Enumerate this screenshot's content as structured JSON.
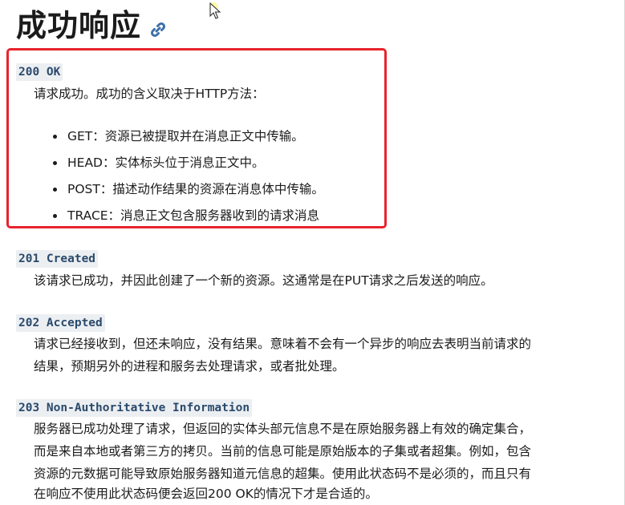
{
  "page": {
    "heading": "成功响应",
    "anchor_icon": "link-icon"
  },
  "colors": {
    "highlight_border": "#e8232c",
    "code_text": "#2b4a6b",
    "code_bg": "#eceff2",
    "link": "#3d6fa8"
  },
  "entries": [
    {
      "code": "200 OK",
      "description": "请求成功。成功的含义取决于HTTP方法：",
      "bullets": [
        "GET：资源已被提取并在消息正文中传输。",
        "HEAD：实体标头位于消息正文中。",
        "POST：描述动作结果的资源在消息体中传输。",
        "TRACE：消息正文包含服务器收到的请求消息"
      ]
    },
    {
      "code": "201 Created",
      "description": "该请求已成功，并因此创建了一个新的资源。这通常是在PUT请求之后发送的响应。"
    },
    {
      "code": "202 Accepted",
      "description_lines": [
        "请求已经接收到，但还未响应，没有结果。意味着不会有一个异步的响应去表明当前请求的",
        "结果，预期另外的进程和服务去处理请求，或者批处理。"
      ]
    },
    {
      "code": "203 Non-Authoritative Information",
      "description_lines": [
        "服务器已成功处理了请求，但返回的实体头部元信息不是在原始服务器上有效的确定集合，",
        "而是来自本地或者第三方的拷贝。当前的信息可能是原始版本的子集或者超集。例如，包含",
        "资源的元数据可能导致原始服务器知道元信息的超集。使用此状态码不是必须的，而且只有",
        "在响应不使用此状态码便会返回200 OK的情况下才是合适的。"
      ]
    }
  ]
}
